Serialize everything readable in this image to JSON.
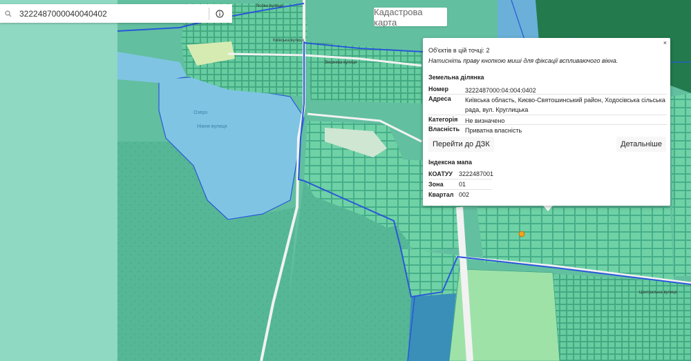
{
  "search": {
    "value": "3222487000040040402",
    "search_icon": "search-icon",
    "info_icon": "info-icon"
  },
  "map": {
    "title": "Кадастрова карта",
    "labels": {
      "lake": "Озеро",
      "street_1": "Лісова вулиця",
      "street_2": "Київська вулиця",
      "street_3": "Вишнева вулиця",
      "street_4": "Центральна вулиця",
      "area_label": "Ніжня вулиця"
    },
    "colors": {
      "land": "#8fd8c2",
      "forest": "#5fb89a",
      "parcel": "#6fcf9e",
      "parcel_dark": "#2f9a7a",
      "water": "#7fbfe3",
      "boundary": "#2a57d8",
      "road": "#f2f2f2",
      "dark_forest": "#237a4d"
    }
  },
  "popup": {
    "close": "×",
    "objects_count": "Об'єктів в цій точці: 2",
    "hint": "Натисніть праву кнопкою миші для фіксації вспливаючого вікна.",
    "land_section": "Земельна ділянка",
    "rows": [
      {
        "key": "Номер",
        "value": "3222487000:04:004:0402"
      },
      {
        "key": "Адреса",
        "value": "Київська область, Києво-Святошинський район, Ходосівська сільська рада, вул. Круглицька"
      },
      {
        "key": "Категорія",
        "value": "Не визначено"
      },
      {
        "key": "Власність",
        "value": "Приватна власність"
      }
    ],
    "goto_button": "Перейти до ДЗК",
    "details_button": "Детальніше",
    "index_section": "Індексна мапа",
    "index_rows": [
      {
        "key": "КОАТУУ",
        "value": "3222487001"
      },
      {
        "key": "Зона",
        "value": "01"
      },
      {
        "key": "Квартал",
        "value": "002"
      }
    ]
  }
}
